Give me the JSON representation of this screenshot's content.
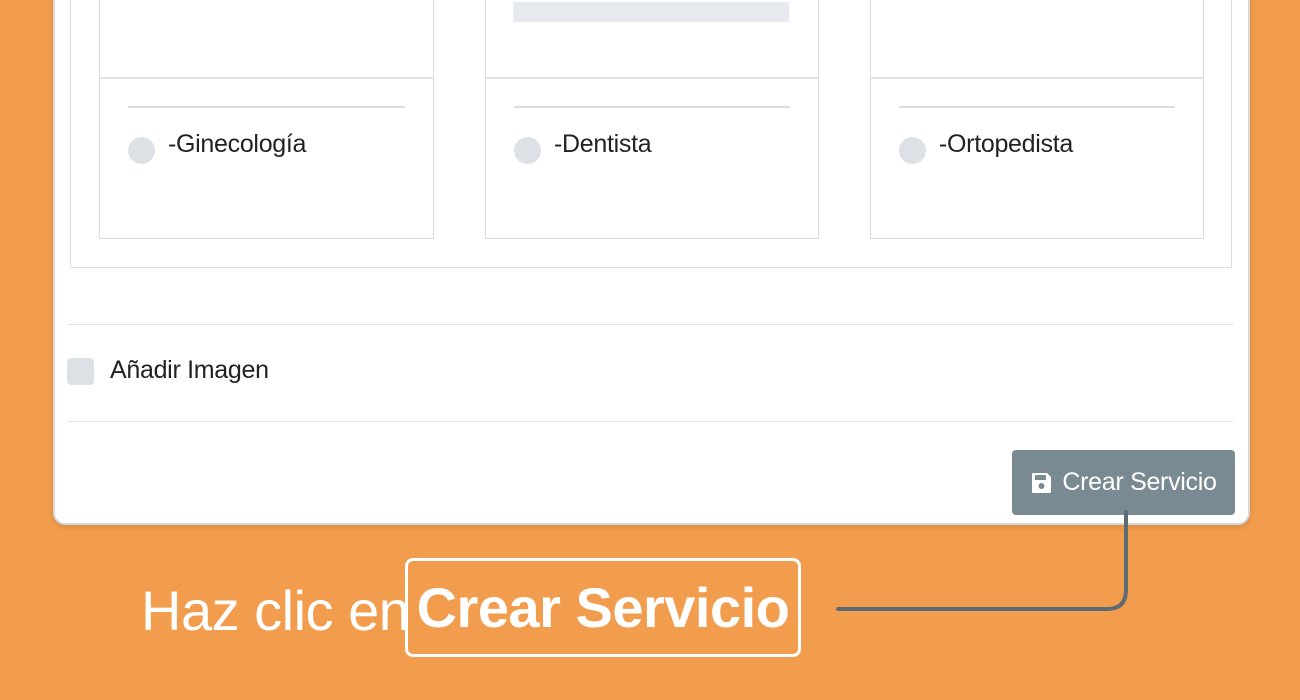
{
  "services": [
    {
      "label": "-Ginecología"
    },
    {
      "label": "-Dentista"
    },
    {
      "label": "-Ortopedista"
    }
  ],
  "add_image": {
    "label": "Añadir Imagen",
    "checked": false
  },
  "create_button": {
    "label": "Crear Servicio",
    "icon": "save-icon"
  },
  "callout": {
    "prefix": "Haz clic en",
    "highlight": "Crear Servicio"
  },
  "colors": {
    "background": "#F29C4D",
    "button": "#7A8A93",
    "connector": "#5F6B72"
  }
}
